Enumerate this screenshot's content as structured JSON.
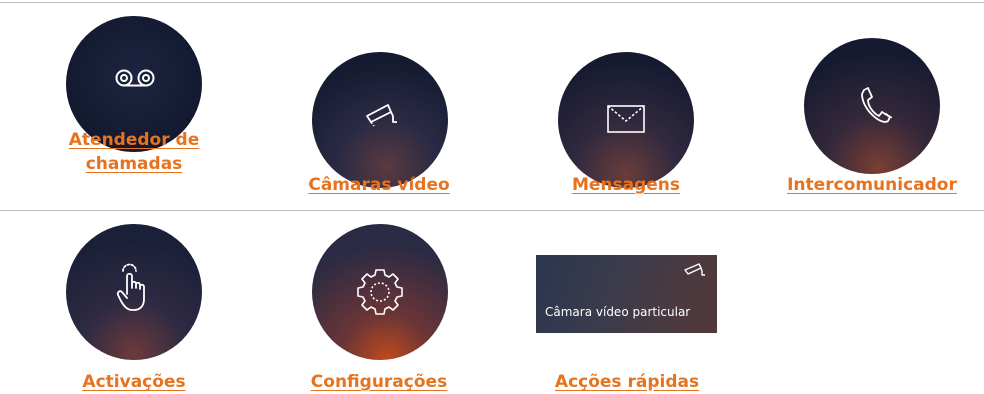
{
  "apps": [
    {
      "id": "answering",
      "icon": "voicemail-icon",
      "label_line1": "Atendedor de ",
      "label_line2": "chamadas"
    },
    {
      "id": "cameras",
      "icon": "security-camera-icon",
      "label": "Câmaras vídeo"
    },
    {
      "id": "messages",
      "icon": "envelope-icon",
      "label": "Mensagens"
    },
    {
      "id": "intercom",
      "icon": "phone-handset-icon",
      "label": "Intercomunicador"
    },
    {
      "id": "activations",
      "icon": "touch-hand-icon",
      "label": "Activações"
    },
    {
      "id": "settings",
      "icon": "gear-icon",
      "label": "Configurações"
    }
  ],
  "quick_action": {
    "widget_text": "Câmara vídeo particular",
    "widget_icon": "security-camera-icon",
    "label": "Acções rápidas"
  },
  "colors": {
    "label_orange": "#e8731e",
    "divider": "#b9b9b9",
    "circle_dark": "#14172b",
    "circle_warm": "#c44a1c"
  }
}
